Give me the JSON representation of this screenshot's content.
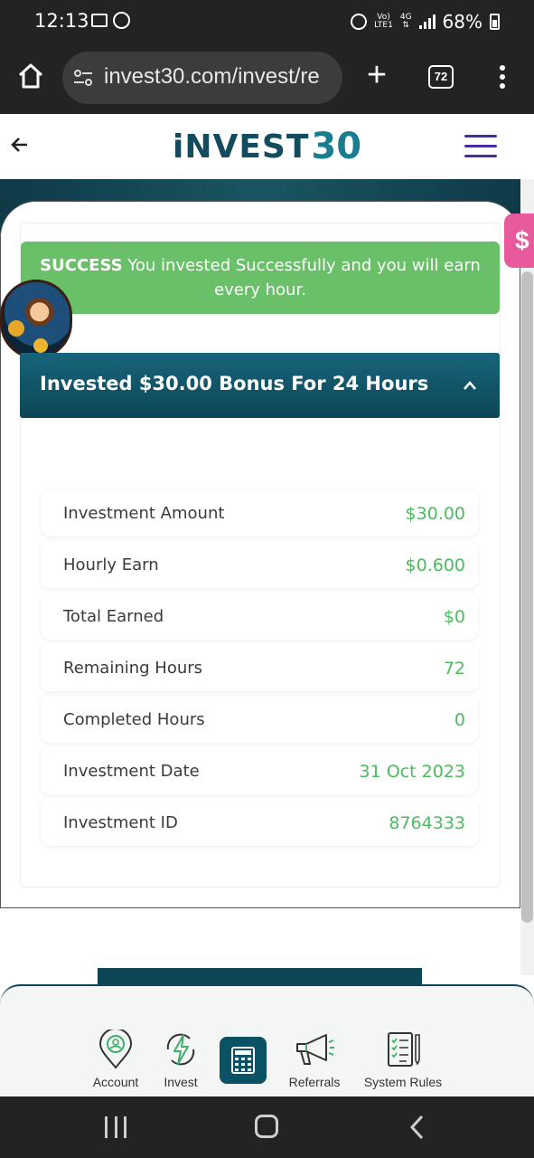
{
  "status_bar": {
    "time": "12:13",
    "network_top": "Vo)",
    "network_bottom": "LTE1",
    "network_gen": "4G",
    "battery_percent": "68%"
  },
  "browser": {
    "url": "invest30.com/invest/re",
    "tab_count": "72"
  },
  "header": {
    "logo_text": "iNVEST",
    "logo_number": "30"
  },
  "side_tab": {
    "label": "$"
  },
  "alert": {
    "strong": "SUCCESS",
    "message": " You invested Successfully and you will earn every hour."
  },
  "accordion": {
    "title": "Invested $30.00 Bonus For 24 Hours"
  },
  "details": [
    {
      "label": "Investment Amount",
      "value": "$30.00"
    },
    {
      "label": "Hourly Earn",
      "value": "$0.600"
    },
    {
      "label": "Total Earned",
      "value": "$0"
    },
    {
      "label": "Remaining Hours",
      "value": "72"
    },
    {
      "label": "Completed Hours",
      "value": "0"
    },
    {
      "label": "Investment Date",
      "value": "31 Oct 2023"
    },
    {
      "label": "Investment ID",
      "value": "8764333"
    }
  ],
  "bottom_nav": {
    "account": "Account",
    "invest": "Invest",
    "referrals": "Referrals",
    "system_rules": "System Rules"
  },
  "colors": {
    "brand_dark": "#0c4657",
    "success_green": "#6abf69",
    "value_green": "#4cba5f",
    "menu_purple": "#4b2aa5"
  }
}
